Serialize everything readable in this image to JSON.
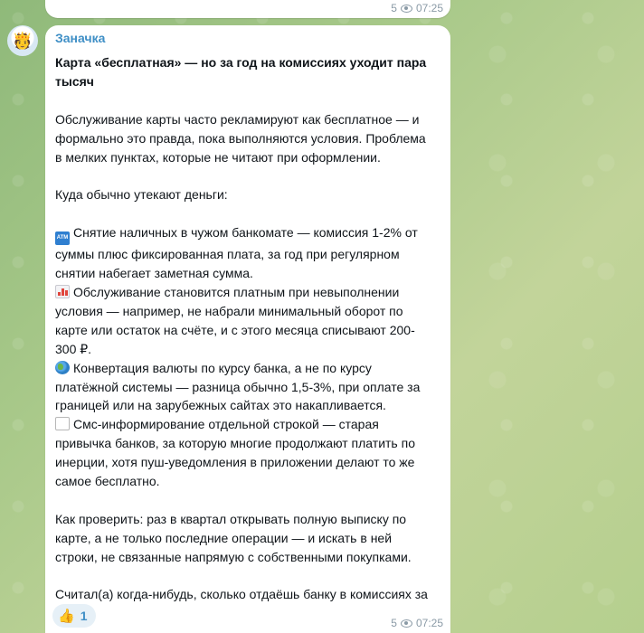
{
  "previous_message": {
    "views": "5",
    "time": "07:25"
  },
  "message": {
    "sender": "Заначка",
    "avatar_icon": "emoji-face-icon",
    "title": "Карта «бесплатная» — но за год на комиссиях уходит пара тысяч",
    "intro": "Обслуживание карты часто рекламируют как бесплатное — и формально это правда, пока выполняются условия. Проблема в мелких пунктах, которые не читают при оформлении.",
    "list_heading": "Куда обычно утекают деньги:",
    "items": [
      {
        "icon": "atm-icon",
        "text": "Снятие наличных в чужом банкомате — комиссия 1-2% от суммы плюс фиксированная плата, за год при регулярном снятии набегает заметная сумма."
      },
      {
        "icon": "bar-chart-icon",
        "text": "Обслуживание становится платным при невыполнении условия — например, не набрали минимальный оборот по карте или остаток на счёте, и с этого месяца списывают 200-300 ₽."
      },
      {
        "icon": "globe-icon",
        "text": "Конвертация валюты по курсу банка, а не по курсу платёжной системы — разница обычно 1,5-3%, при оплате за границей или на зарубежных сайтах это накапливается."
      },
      {
        "icon": "document-icon",
        "text": "Смс-информирование отдельной строкой — старая привычка банков, за которую многие продолжают платить по инерции, хотя пуш-уведомления в приложении делают то же самое бесплатно."
      }
    ],
    "check": "Как проверить: раз в квартал открывать полную выписку по карте, а не только последние операции — и искать в ней строки, не связанные напрямую с собственными покупками.",
    "question": "Считал(а) когда-нибудь, сколько отдаёшь банку в комиссиях за год?",
    "reaction": {
      "emoji": "👍",
      "count": "1"
    },
    "views": "5",
    "time": "07:25"
  },
  "colors": {
    "accent": "#3f8fc6",
    "bubble": "#ffffff",
    "meta": "#8a9aa6"
  }
}
